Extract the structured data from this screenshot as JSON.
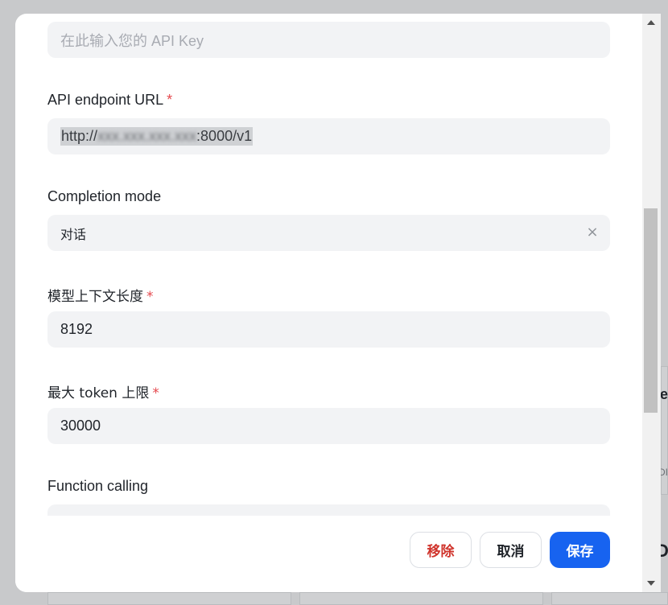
{
  "background": {
    "partial_text_right": "e",
    "partial_small_right": "DI",
    "partial_bold_right": "D"
  },
  "form": {
    "api_key": {
      "placeholder": "在此输入您的 API Key"
    },
    "endpoint": {
      "label": "API endpoint URL",
      "required": "*",
      "value_visible_start": "http://",
      "value_obscured": "xxx.xxx.xxx.xxx",
      "value_visible_end": ":8000/v1"
    },
    "completion_mode": {
      "label": "Completion mode",
      "value": "对话",
      "clear_icon": "×"
    },
    "context_length": {
      "label": "模型上下文长度",
      "required": "*",
      "value": "8192"
    },
    "max_tokens": {
      "label": "最大 token 上限",
      "required": "*",
      "value": "30000"
    },
    "function_calling": {
      "label": "Function calling"
    }
  },
  "footer": {
    "remove_label": "移除",
    "cancel_label": "取消",
    "save_label": "保存"
  },
  "colors": {
    "primary": "#1763f0",
    "danger": "#d0342c",
    "required": "#e5484d",
    "input_bg": "#f2f3f5"
  }
}
